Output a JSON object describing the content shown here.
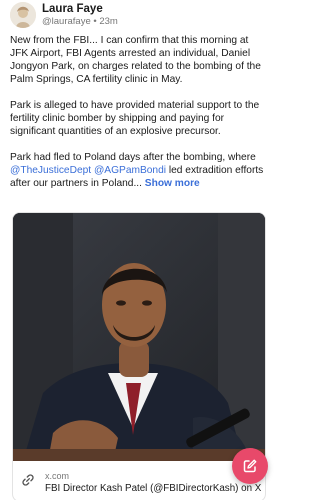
{
  "post": {
    "author": {
      "display_name": "Laura Faye",
      "handle": "@laurafaye",
      "separator": "•",
      "time": "23m"
    },
    "paragraph_1": "New from the FBI... I can confirm that this morning at JFK Airport, FBI Agents arrested an individual, Daniel Jongyon Park, on charges related to the bombing of the Palm Springs, CA fertility clinic in May.",
    "paragraph_2": "Park is alleged to have provided material support to the fertility clinic bomber by shipping and paying for significant quantities of an explosive precursor.",
    "paragraph_3": {
      "before": "Park had fled to Poland days after the bombing, where ",
      "mention_1": "@TheJusticeDept",
      "between": " ",
      "mention_2": "@AGPamBondi",
      "after": " led extradition efforts after our partners in Poland...",
      "show_more": "Show more"
    },
    "link_card": {
      "domain": "x.com",
      "title": "FBI Director Kash Patel (@FBIDirectorKash) on X"
    }
  },
  "icons": {
    "avatar": "profile-photo",
    "link": "link-icon",
    "compose": "pencil-square-icon"
  },
  "colors": {
    "link": "#3b6fd8",
    "fab": "#e8496a",
    "text": "#1a1a1a",
    "muted": "#777777"
  }
}
